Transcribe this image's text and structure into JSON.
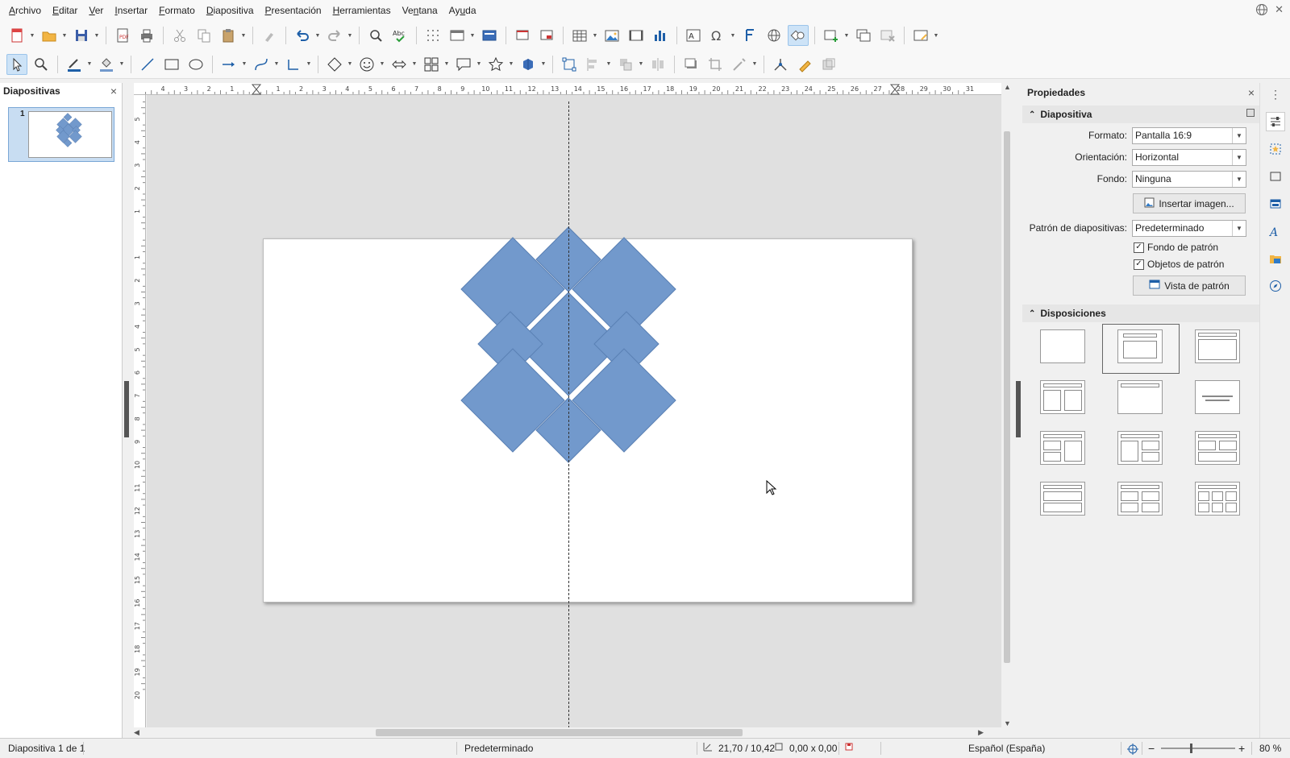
{
  "menu": {
    "items": [
      {
        "pre": "",
        "ul": "A",
        "post": "rchivo"
      },
      {
        "pre": "",
        "ul": "E",
        "post": "ditar"
      },
      {
        "pre": "",
        "ul": "V",
        "post": "er"
      },
      {
        "pre": "",
        "ul": "I",
        "post": "nsertar"
      },
      {
        "pre": "",
        "ul": "F",
        "post": "ormato"
      },
      {
        "pre": "",
        "ul": "D",
        "post": "iapositiva"
      },
      {
        "pre": "",
        "ul": "P",
        "post": "resentación"
      },
      {
        "pre": "",
        "ul": "H",
        "post": "erramientas"
      },
      {
        "pre": "Ve",
        "ul": "n",
        "post": "tana"
      },
      {
        "pre": "Ay",
        "ul": "u",
        "post": "da"
      }
    ]
  },
  "slide_pane": {
    "title": "Diapositivas",
    "close": "×",
    "slide_number": "1"
  },
  "properties": {
    "title": "Propiedades",
    "close": "×",
    "section_slide": "Diapositiva",
    "format_label": "Formato:",
    "format_value": "Pantalla 16:9",
    "orientation_label": "Orientación:",
    "orientation_value": "Horizontal",
    "background_label": "Fondo:",
    "background_value": "Ninguna",
    "insert_image": "Insertar imagen...",
    "master_label": "Patrón de diapositivas:",
    "master_value": "Predeterminado",
    "master_bg": "Fondo de patrón",
    "master_objects": "Objetos de patrón",
    "master_view": "Vista de patrón",
    "section_layouts": "Disposiciones"
  },
  "status": {
    "slide_info": "Diapositiva 1 de 1",
    "master": "Predeterminado",
    "position": "21,70 / 10,42",
    "size": "0,00 x 0,00",
    "language": "Español (España)",
    "zoom": "80 %"
  },
  "rulers": {
    "h_labels": [
      "4",
      "3",
      "2",
      "1",
      "",
      "1",
      "2",
      "3",
      "4",
      "5",
      "6",
      "7",
      "8",
      "9",
      "10",
      "11",
      "12",
      "13",
      "14",
      "15",
      "16",
      "17",
      "18",
      "19",
      "20",
      "21",
      "22",
      "23",
      "24",
      "25",
      "26",
      "27",
      "28",
      "29",
      "30",
      "31"
    ],
    "v_labels": [
      "5",
      "4",
      "3",
      "2",
      "1",
      "",
      "1",
      "2",
      "3",
      "4",
      "5",
      "6",
      "7",
      "8",
      "9",
      "10",
      "11",
      "12",
      "13",
      "14",
      "15",
      "16",
      "17",
      "18",
      "19",
      "20"
    ]
  },
  "colors": {
    "shape_fill": "#7299cc",
    "shape_stroke": "#5a80b4",
    "accent": "#1e5fa8"
  }
}
